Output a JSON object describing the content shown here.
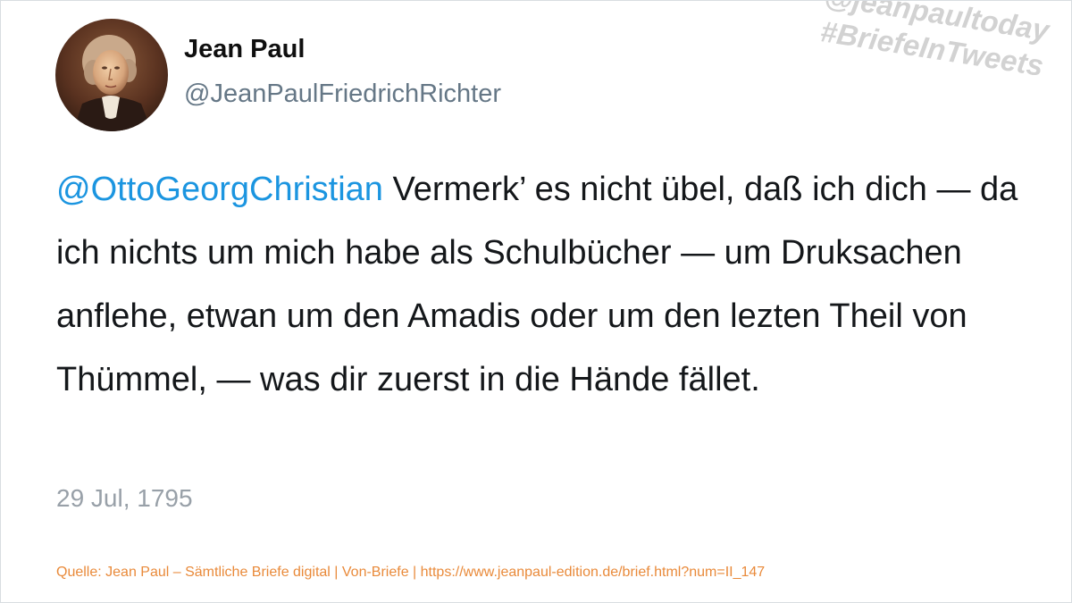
{
  "author": {
    "display_name": "Jean Paul",
    "handle": "@JeanPaulFriedrichRichter",
    "avatar_icon": "portrait-avatar-icon"
  },
  "watermark": {
    "line1": "@jeanpaultoday",
    "line2": "#BriefeInTweets",
    "color": "#d2d2d2"
  },
  "tweet": {
    "mention": "@OttoGeorgChristian",
    "body": " Vermerk’ es nicht übel, daß ich dich — da ich nichts um mich habe als Schulbücher — um Druksachen anflehe, etwan um den Amadis oder um den lezten Theil von Thümmel, — was dir zuerst in die Hände fället.",
    "date": "29 Jul, 1795",
    "mention_color": "#1b95e0"
  },
  "footer": {
    "source": "Quelle: Jean Paul – Sämtliche Briefe digital | Von-Briefe | https://www.jeanpaul-edition.de/brief.html?num=II_147",
    "color": "#e98a3a"
  }
}
